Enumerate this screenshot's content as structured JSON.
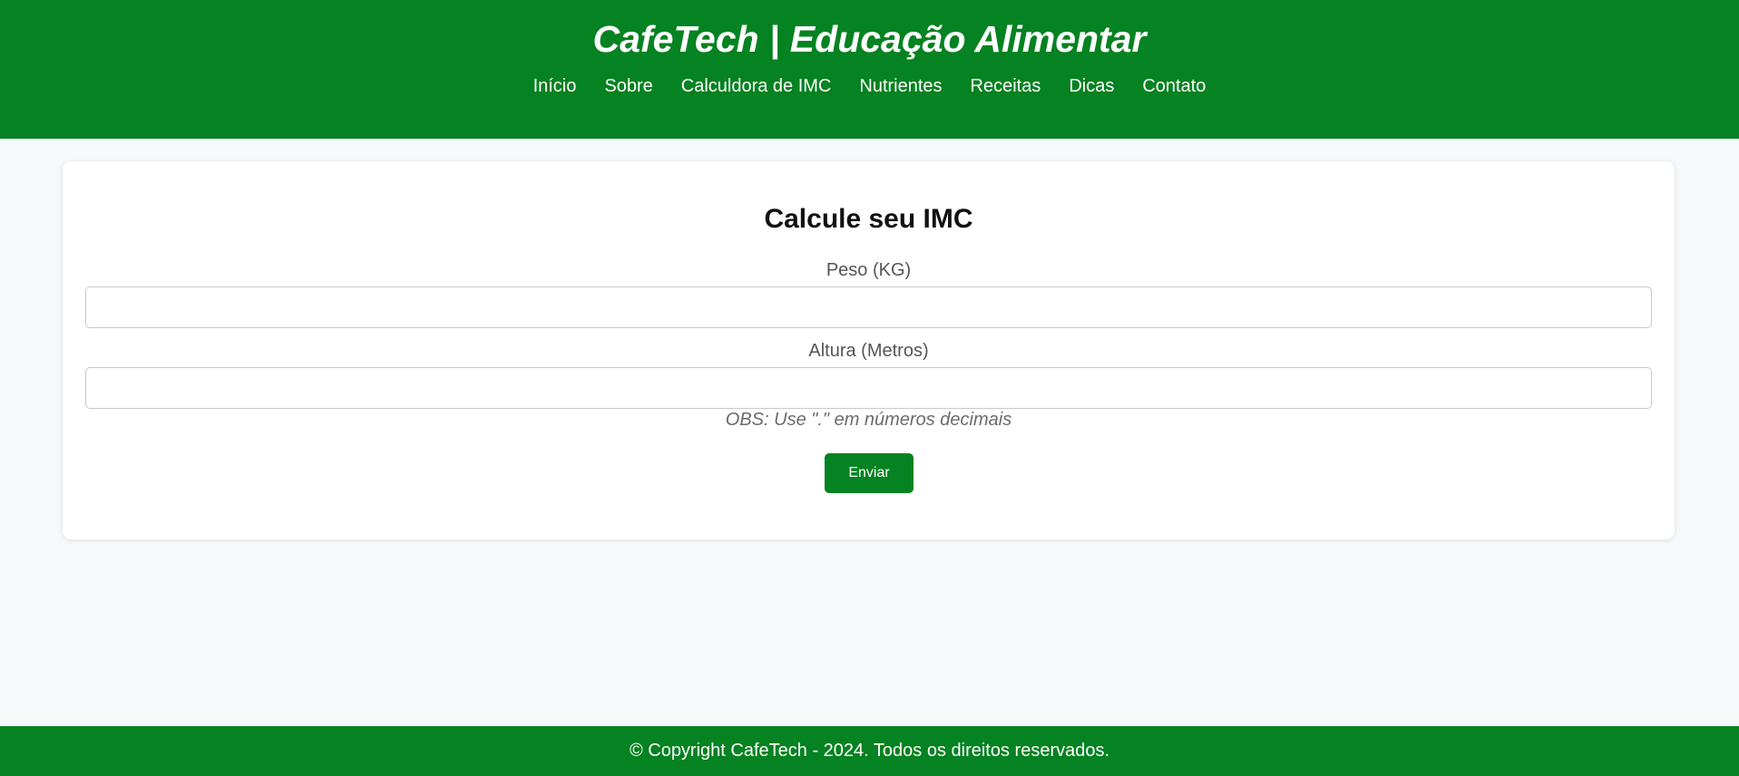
{
  "header": {
    "title": "CafeTech | Educação Alimentar",
    "nav": [
      {
        "label": "Início"
      },
      {
        "label": "Sobre"
      },
      {
        "label": "Calculdora de IMC"
      },
      {
        "label": "Nutrientes"
      },
      {
        "label": "Receitas"
      },
      {
        "label": "Dicas"
      },
      {
        "label": "Contato"
      }
    ]
  },
  "form": {
    "title": "Calcule seu IMC",
    "weight_label": "Peso (KG)",
    "weight_value": "",
    "height_label": "Altura (Metros)",
    "height_value": "",
    "note": "OBS: Use \".\" em números decimais",
    "submit_label": "Enviar"
  },
  "footer": {
    "text": "© Copyright CafeTech - 2024. Todos os direitos reservados."
  },
  "colors": {
    "brand_green": "#058221",
    "page_background": "#f6f8fa",
    "card_background": "#ffffff"
  }
}
